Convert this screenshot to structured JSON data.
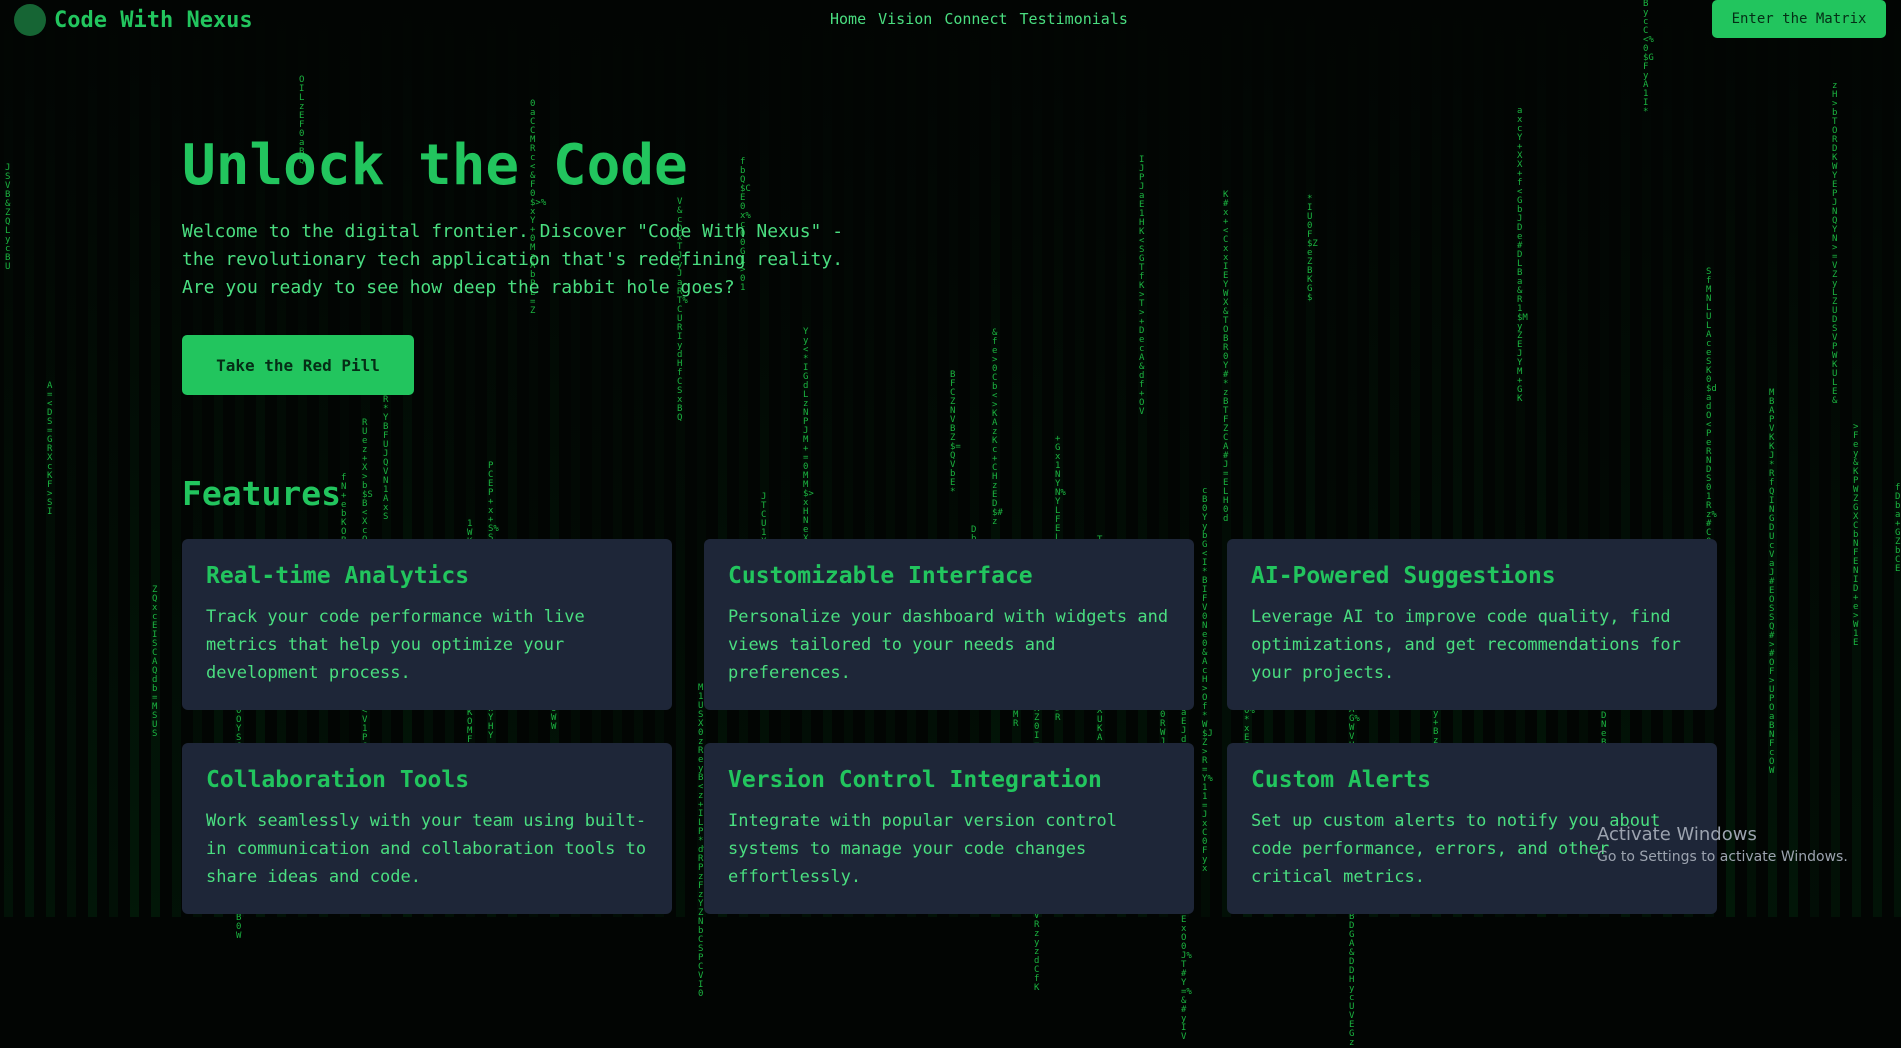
{
  "brand": {
    "name": "Code With Nexus"
  },
  "nav": {
    "links": [
      "Home",
      "Vision",
      "Connect",
      "Testimonials"
    ],
    "cta_label": "Enter the Matrix"
  },
  "hero": {
    "title": "Unlock the Code",
    "text": "Welcome to the digital frontier. Discover \"Code With Nexus\" - the revolutionary tech application that's redefining reality. Are you ready to see how deep the rabbit hole goes?",
    "button_label": "Take the Red Pill"
  },
  "features": {
    "heading": "Features",
    "cards": [
      {
        "title": "Real-time Analytics",
        "text": "Track your code performance with live metrics that help you optimize your development process."
      },
      {
        "title": "Customizable Interface",
        "text": "Personalize your dashboard with widgets and views tailored to your needs and preferences."
      },
      {
        "title": "AI-Powered Suggestions",
        "text": "Leverage AI to improve code quality, find optimizations, and get recommendations for your projects."
      },
      {
        "title": "Collaboration Tools",
        "text": "Work seamlessly with your team using built-in communication and collaboration tools to share ideas and code."
      },
      {
        "title": "Version Control Integration",
        "text": "Integrate with popular version control systems to manage your code changes effortlessly."
      },
      {
        "title": "Custom Alerts",
        "text": "Set up custom alerts to notify you about code performance, errors, and other critical metrics."
      }
    ]
  },
  "watermark": {
    "title": "Activate Windows",
    "subtitle": "Go to Settings to activate Windows."
  },
  "colors": {
    "accent": "#22c55e",
    "card_bg": "#1e2638",
    "background": "#020503"
  }
}
